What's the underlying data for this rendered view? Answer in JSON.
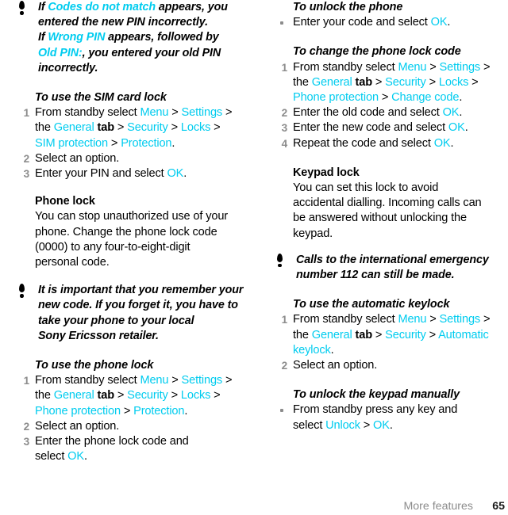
{
  "document": {
    "footer_label": "More features",
    "page_number": "65",
    "accent_color": "#00ccef",
    "step_number_color": "#8c8c8c",
    "text_color": "#000000"
  },
  "left_column": {
    "note_1": {
      "icon": "exclamation-note-icon",
      "lines": [
        [
          {
            "t": "If ",
            "s": "plain"
          },
          {
            "t": "Codes do not match",
            "s": "accent"
          },
          {
            "t": " appears, you",
            "s": "plain"
          }
        ],
        [
          {
            "t": "entered the new PIN incorrectly.",
            "s": "plain"
          }
        ],
        [
          {
            "t": "If ",
            "s": "plain"
          },
          {
            "t": "Wrong PIN",
            "s": "accent"
          },
          {
            "t": " appears, followed by",
            "s": "plain"
          }
        ],
        [
          {
            "t": "Old PIN:",
            "s": "accent"
          },
          {
            "t": ", you entered your old PIN",
            "s": "plain"
          }
        ],
        [
          {
            "t": "incorrectly.",
            "s": "plain"
          }
        ]
      ]
    },
    "sim_lock": {
      "heading": "To use the SIM card lock",
      "steps": [
        {
          "num": "1",
          "lines": [
            [
              {
                "t": "From standby select ",
                "s": "plain"
              },
              {
                "t": "Menu",
                "s": "accent"
              },
              {
                "t": " > ",
                "s": "plain"
              },
              {
                "t": "Settings",
                "s": "accent"
              },
              {
                "t": " >",
                "s": "plain"
              }
            ],
            [
              {
                "t": "the ",
                "s": "plain"
              },
              {
                "t": "General",
                "s": "accent"
              },
              {
                "t": " tab",
                "s": "bold"
              },
              {
                "t": " > ",
                "s": "plain"
              },
              {
                "t": "Security",
                "s": "accent"
              },
              {
                "t": " > ",
                "s": "plain"
              },
              {
                "t": "Locks",
                "s": "accent"
              },
              {
                "t": " >",
                "s": "plain"
              }
            ],
            [
              {
                "t": "SIM protection",
                "s": "accent"
              },
              {
                "t": " > ",
                "s": "plain"
              },
              {
                "t": "Protection",
                "s": "accent"
              },
              {
                "t": ".",
                "s": "plain"
              }
            ]
          ]
        },
        {
          "num": "2",
          "lines": [
            [
              {
                "t": "Select an option.",
                "s": "plain"
              }
            ]
          ]
        },
        {
          "num": "3",
          "lines": [
            [
              {
                "t": "Enter your PIN and select ",
                "s": "plain"
              },
              {
                "t": "OK",
                "s": "accent"
              },
              {
                "t": ".",
                "s": "plain"
              }
            ]
          ]
        }
      ]
    },
    "phone_lock_section": {
      "heading": "Phone lock",
      "body_lines": [
        "You can stop unauthorized use of your",
        "phone. Change the phone lock code",
        "(0000) to any four-to-eight-digit",
        "personal code."
      ]
    },
    "note_2": {
      "icon": "exclamation-note-icon",
      "lines": [
        [
          {
            "t": "It is important that you remember your",
            "s": "plain"
          }
        ],
        [
          {
            "t": "new code. If you forget it, you have to",
            "s": "plain"
          }
        ],
        [
          {
            "t": "take your phone to your local",
            "s": "plain"
          }
        ],
        [
          {
            "t": "Sony Ericsson retailer.",
            "s": "plain"
          }
        ]
      ]
    },
    "phone_lock_use": {
      "heading": "To use the phone lock",
      "steps": [
        {
          "num": "1",
          "lines": [
            [
              {
                "t": "From standby select ",
                "s": "plain"
              },
              {
                "t": "Menu",
                "s": "accent"
              },
              {
                "t": " > ",
                "s": "plain"
              },
              {
                "t": "Settings",
                "s": "accent"
              },
              {
                "t": " >",
                "s": "plain"
              }
            ],
            [
              {
                "t": "the ",
                "s": "plain"
              },
              {
                "t": "General",
                "s": "accent"
              },
              {
                "t": " tab",
                "s": "bold"
              },
              {
                "t": " > ",
                "s": "plain"
              },
              {
                "t": "Security",
                "s": "accent"
              },
              {
                "t": " > ",
                "s": "plain"
              },
              {
                "t": "Locks",
                "s": "accent"
              },
              {
                "t": " >",
                "s": "plain"
              }
            ],
            [
              {
                "t": "Phone protection",
                "s": "accent"
              },
              {
                "t": " > ",
                "s": "plain"
              },
              {
                "t": "Protection",
                "s": "accent"
              },
              {
                "t": ".",
                "s": "plain"
              }
            ]
          ]
        },
        {
          "num": "2",
          "lines": [
            [
              {
                "t": "Select an option.",
                "s": "plain"
              }
            ]
          ]
        },
        {
          "num": "3",
          "lines": [
            [
              {
                "t": "Enter the phone lock code and",
                "s": "plain"
              }
            ],
            [
              {
                "t": "select ",
                "s": "plain"
              },
              {
                "t": "OK",
                "s": "accent"
              },
              {
                "t": ".",
                "s": "plain"
              }
            ]
          ]
        }
      ]
    }
  },
  "right_column": {
    "unlock_phone": {
      "heading": "To unlock the phone",
      "bullets": [
        {
          "lines": [
            [
              {
                "t": "Enter your code and select ",
                "s": "plain"
              },
              {
                "t": "OK",
                "s": "accent"
              },
              {
                "t": ".",
                "s": "plain"
              }
            ]
          ]
        }
      ]
    },
    "change_code": {
      "heading": "To change the phone lock code",
      "steps": [
        {
          "num": "1",
          "lines": [
            [
              {
                "t": "From standby select ",
                "s": "plain"
              },
              {
                "t": "Menu",
                "s": "accent"
              },
              {
                "t": " > ",
                "s": "plain"
              },
              {
                "t": "Settings",
                "s": "accent"
              },
              {
                "t": " >",
                "s": "plain"
              }
            ],
            [
              {
                "t": "the ",
                "s": "plain"
              },
              {
                "t": "General",
                "s": "accent"
              },
              {
                "t": " tab",
                "s": "bold"
              },
              {
                "t": " > ",
                "s": "plain"
              },
              {
                "t": "Security",
                "s": "accent"
              },
              {
                "t": " > ",
                "s": "plain"
              },
              {
                "t": "Locks",
                "s": "accent"
              },
              {
                "t": " >",
                "s": "plain"
              }
            ],
            [
              {
                "t": "Phone protection",
                "s": "accent"
              },
              {
                "t": " > ",
                "s": "plain"
              },
              {
                "t": "Change code",
                "s": "accent"
              },
              {
                "t": ".",
                "s": "plain"
              }
            ]
          ]
        },
        {
          "num": "2",
          "lines": [
            [
              {
                "t": "Enter the old code and select ",
                "s": "plain"
              },
              {
                "t": "OK",
                "s": "accent"
              },
              {
                "t": ".",
                "s": "plain"
              }
            ]
          ]
        },
        {
          "num": "3",
          "lines": [
            [
              {
                "t": "Enter the new code and select ",
                "s": "plain"
              },
              {
                "t": "OK",
                "s": "accent"
              },
              {
                "t": ".",
                "s": "plain"
              }
            ]
          ]
        },
        {
          "num": "4",
          "lines": [
            [
              {
                "t": "Repeat the code and select ",
                "s": "plain"
              },
              {
                "t": "OK",
                "s": "accent"
              },
              {
                "t": ".",
                "s": "plain"
              }
            ]
          ]
        }
      ]
    },
    "keypad_lock_section": {
      "heading": "Keypad lock",
      "body_lines": [
        "You can set this lock to avoid",
        "accidental dialling. Incoming calls can",
        "be answered without unlocking the",
        "keypad."
      ]
    },
    "note_1": {
      "icon": "exclamation-note-icon",
      "lines": [
        [
          {
            "t": "Calls to the international emergency",
            "s": "plain"
          }
        ],
        [
          {
            "t": "number 112 can still be made.",
            "s": "plain"
          }
        ]
      ]
    },
    "auto_keylock": {
      "heading": "To use the automatic keylock",
      "steps": [
        {
          "num": "1",
          "lines": [
            [
              {
                "t": "From standby select ",
                "s": "plain"
              },
              {
                "t": "Menu",
                "s": "accent"
              },
              {
                "t": " > ",
                "s": "plain"
              },
              {
                "t": "Settings",
                "s": "accent"
              },
              {
                "t": " >",
                "s": "plain"
              }
            ],
            [
              {
                "t": "the ",
                "s": "plain"
              },
              {
                "t": "General",
                "s": "accent"
              },
              {
                "t": " tab",
                "s": "bold"
              },
              {
                "t": " > ",
                "s": "plain"
              },
              {
                "t": "Security",
                "s": "accent"
              },
              {
                "t": " > ",
                "s": "plain"
              },
              {
                "t": "Automatic",
                "s": "accent"
              }
            ],
            [
              {
                "t": "keylock",
                "s": "accent"
              },
              {
                "t": ".",
                "s": "plain"
              }
            ]
          ]
        },
        {
          "num": "2",
          "lines": [
            [
              {
                "t": "Select an option.",
                "s": "plain"
              }
            ]
          ]
        }
      ]
    },
    "unlock_keypad": {
      "heading": "To unlock the keypad manually",
      "bullets": [
        {
          "lines": [
            [
              {
                "t": "From standby press any key and",
                "s": "plain"
              }
            ],
            [
              {
                "t": "select ",
                "s": "plain"
              },
              {
                "t": "Unlock",
                "s": "accent"
              },
              {
                "t": " > ",
                "s": "plain"
              },
              {
                "t": "OK",
                "s": "accent"
              },
              {
                "t": ".",
                "s": "plain"
              }
            ]
          ]
        }
      ]
    }
  }
}
